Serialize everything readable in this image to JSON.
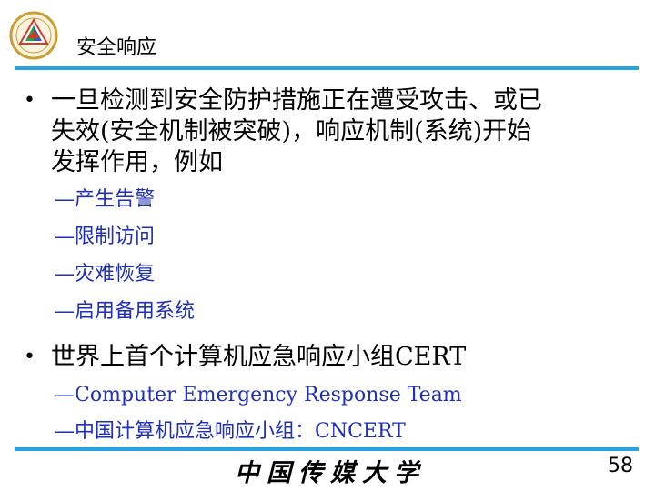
{
  "header": {
    "title": "安全响应"
  },
  "bullets": [
    {
      "lines": [
        "一旦检测到安全防护措施正在遭受攻击、或已",
        "失效(安全机制被突破)，响应机制(系统)开始",
        "发挥作用，例如"
      ],
      "subitems": [
        "—产生告警",
        "—限制访问",
        "—灾难恢复",
        "—启用备用系统"
      ]
    },
    {
      "lines": [
        "世界上首个计算机应急响应小组CERT"
      ],
      "subitems": [
        "—Computer Emergency Response Team",
        "—中国计算机应急响应小组：CNCERT"
      ]
    }
  ],
  "footer": {
    "brand": "中国传媒大学",
    "page_number": "58"
  },
  "colors": {
    "rule": "#29a3e0",
    "subitem_text": "#1f2fb8",
    "logo_red": "#d23a2a",
    "logo_blue": "#2b5fb0",
    "logo_green": "#2f9a45",
    "logo_gold": "#c8a032"
  }
}
